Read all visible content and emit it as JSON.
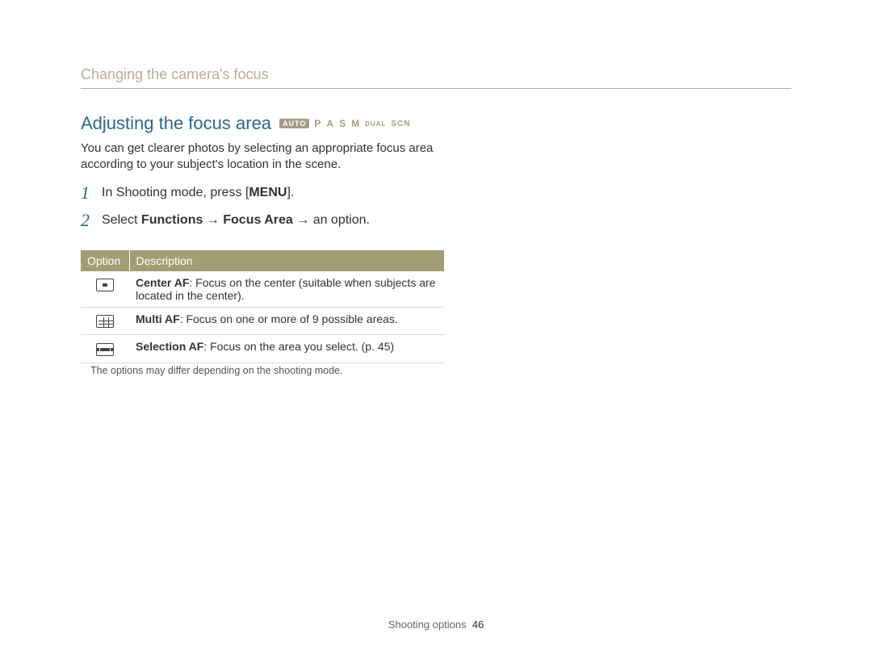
{
  "header": {
    "breadcrumb": "Changing the camera's focus"
  },
  "section": {
    "title": "Adjusting the focus area",
    "modes": {
      "auto": "AUTO",
      "p": "P",
      "a": "A",
      "s": "S",
      "m": "M",
      "dual": "DUAL",
      "scn": "SCN"
    },
    "intro": "You can get clearer photos by selecting an appropriate focus area according to your subject's location in the scene."
  },
  "steps": [
    {
      "num": "1",
      "prefix": "In Shooting mode, press [",
      "bold1": "MENU",
      "suffix": "]."
    },
    {
      "num": "2",
      "prefix": "Select ",
      "bold1": "Functions",
      "arrow1": " → ",
      "bold2": "Focus Area",
      "arrow2": " → ",
      "suffix2": "an option."
    }
  ],
  "table": {
    "header_option": "Option",
    "header_desc": "Description",
    "rows": [
      {
        "icon": "center-af-icon",
        "bold": "Center AF",
        "rest": ": Focus on the center (suitable when subjects are located in the center)."
      },
      {
        "icon": "multi-af-icon",
        "bold": "Multi AF",
        "rest": ": Focus on one or more of 9 possible areas."
      },
      {
        "icon": "selection-af-icon",
        "bold": "Selection AF",
        "rest": ": Focus on the area you select. (p. 45)"
      }
    ],
    "note": "The options may differ depending on the shooting mode."
  },
  "footer": {
    "section": "Shooting options",
    "page": "46"
  }
}
